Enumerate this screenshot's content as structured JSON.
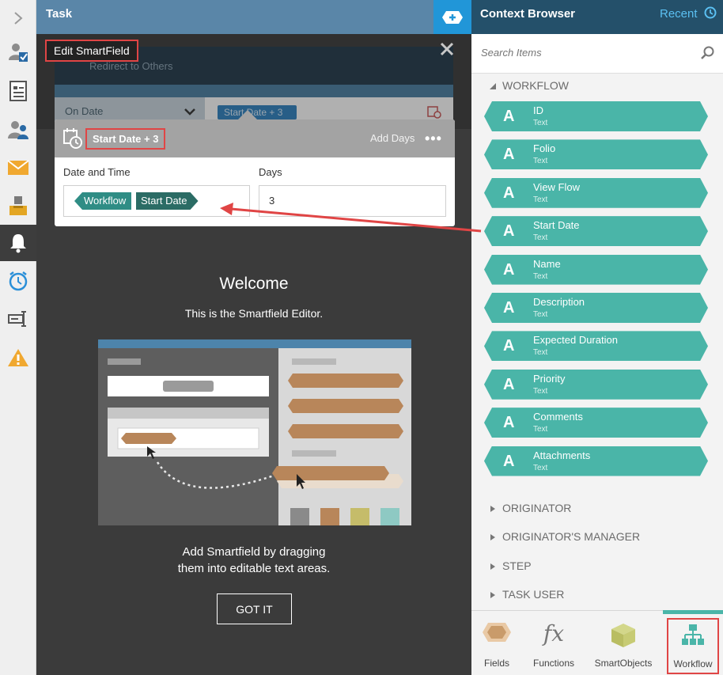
{
  "rail": {
    "items": [
      {
        "icon": "chevron-right-icon"
      },
      {
        "icon": "user-check-icon"
      },
      {
        "icon": "form-icon"
      },
      {
        "icon": "users-icon"
      },
      {
        "icon": "envelope-icon"
      },
      {
        "icon": "inbox-tray-icon"
      },
      {
        "icon": "bell-icon"
      },
      {
        "icon": "alarm-clock-icon"
      },
      {
        "icon": "text-cursor-icon"
      },
      {
        "icon": "warning-icon"
      }
    ]
  },
  "task": {
    "title": "Task"
  },
  "modal": {
    "title": "Edit SmartField",
    "background": {
      "faded_action": "Redirect to Others",
      "select_value": "On Date",
      "pill_value": "Start Date + 3"
    }
  },
  "smartfield": {
    "name": "Start Date + 3",
    "action": "Add Days",
    "more": "•••",
    "date_label": "Date and Time",
    "days_label": "Days",
    "date_tag": {
      "source": "Workflow",
      "field": "Start Date"
    },
    "days_value": "3"
  },
  "welcome": {
    "title": "Welcome",
    "subtitle": "This is the Smartfield Editor.",
    "desc_line1": "Add Smartfield by dragging",
    "desc_line2": "them into editable text areas.",
    "button": "GOT IT"
  },
  "context_browser": {
    "title": "Context Browser",
    "recent": "Recent",
    "search_placeholder": "Search Items",
    "workflow_section": "WORKFLOW",
    "items": [
      {
        "glyph": "A",
        "name": "ID",
        "type": "Text"
      },
      {
        "glyph": "A",
        "name": "Folio",
        "type": "Text"
      },
      {
        "glyph": "A",
        "name": "View Flow",
        "type": "Text"
      },
      {
        "glyph": "A",
        "name": "Start Date",
        "type": "Text"
      },
      {
        "glyph": "A",
        "name": "Name",
        "type": "Text"
      },
      {
        "glyph": "A",
        "name": "Description",
        "type": "Text"
      },
      {
        "glyph": "A",
        "name": "Expected Duration",
        "type": "Text"
      },
      {
        "glyph": "A",
        "name": "Priority",
        "type": "Text"
      },
      {
        "glyph": "A",
        "name": "Comments",
        "type": "Text"
      },
      {
        "glyph": "A",
        "name": "Attachments",
        "type": "Text"
      }
    ],
    "sections": [
      "ORIGINATOR",
      "ORIGINATOR'S MANAGER",
      "STEP",
      "TASK USER"
    ],
    "tabs": [
      "Fields",
      "Functions",
      "SmartObjects",
      "Workflow"
    ],
    "active_tab": "Workflow"
  },
  "colors": {
    "accent_teal": "#4ab5a8",
    "header_blue": "#24506a",
    "highlight_red": "#e04545"
  }
}
